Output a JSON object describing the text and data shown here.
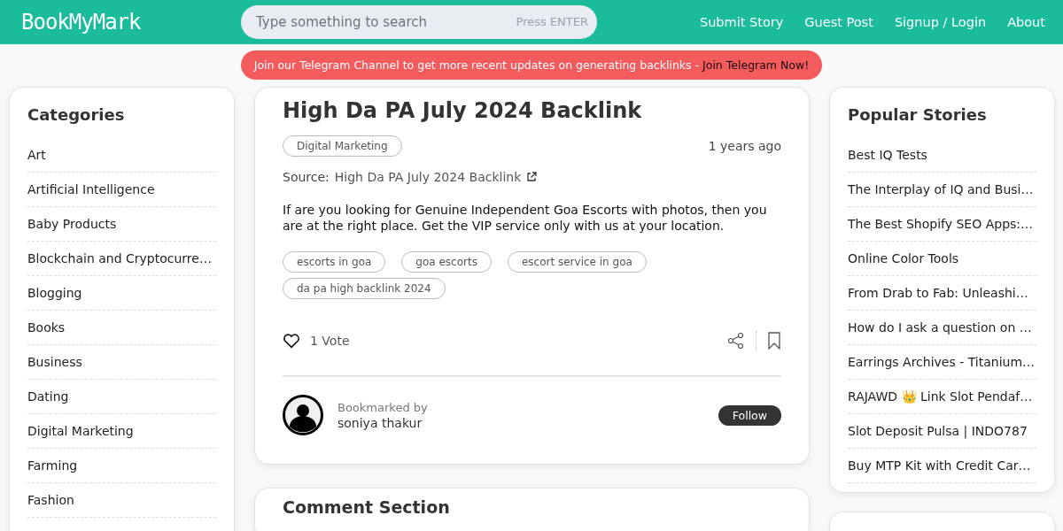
{
  "header": {
    "logo": "BookMyMark",
    "search": {
      "placeholder": "Type something to search",
      "hint": "Press ENTER"
    },
    "nav": [
      "Submit Story",
      "Guest Post",
      "Signup / Login",
      "About"
    ]
  },
  "banner": {
    "text": "Join our Telegram Channel to get more recent updates on generating backlinks - ",
    "link": "Join Telegram Now!"
  },
  "categories": {
    "title": "Categories",
    "items": [
      "Art",
      "Artificial Intelligence",
      "Baby Products",
      "Blockchain and Cryptocurre…",
      "Blogging",
      "Books",
      "Business",
      "Dating",
      "Digital Marketing",
      "Farming",
      "Fashion"
    ]
  },
  "story": {
    "title": "High Da PA July 2024 Backlink",
    "category": "Digital Marketing",
    "age": "1 years ago",
    "source_label": "Source:",
    "source_link": "High Da PA July 2024 Backlink",
    "description": "If are you looking for Genuine Independent Goa Escorts with photos, then you are at the right place. Get the VIP service only with us at your location.",
    "tags": [
      "escorts in goa",
      "goa escorts",
      "escort service in goa",
      "da pa high backlink 2024"
    ],
    "votes": "1 Vote",
    "bookmarked_by_label": "Bookmarked by",
    "author": "soniya thakur",
    "follow": "Follow"
  },
  "comments": {
    "title": "Comment Section"
  },
  "popular": {
    "title": "Popular Stories",
    "items": [
      "Best IQ Tests",
      "The Interplay of IQ and Busi…",
      "The Best Shopify SEO Apps:…",
      "Online Color Tools",
      "From Drab to Fab: Unleashi…",
      "How do I ask a question on …",
      "Earrings Archives - Titanium…",
      "RAJAWD 👑 Link Slot Pendaf…",
      "Slot Deposit Pulsa | INDO787",
      "Buy MTP Kit with Credit Car…"
    ]
  }
}
